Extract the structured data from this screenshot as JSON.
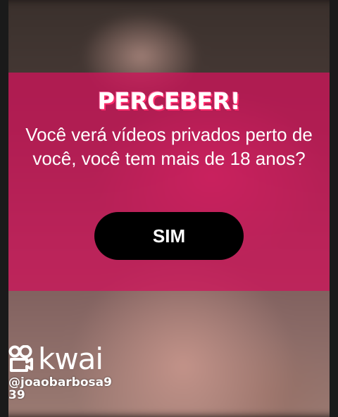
{
  "dialog": {
    "title": "PERCEBER!",
    "message": "Você verá vídeos privados perto de você, você tem mais de 18 anos?",
    "confirm_label": "SIM"
  },
  "watermark": {
    "brand": "kwai",
    "icon": "kwai-logo-icon",
    "handle": "@joaobarbosa939"
  },
  "colors": {
    "overlay": "#cd145a",
    "button": "#000000",
    "text": "#ffffff"
  }
}
